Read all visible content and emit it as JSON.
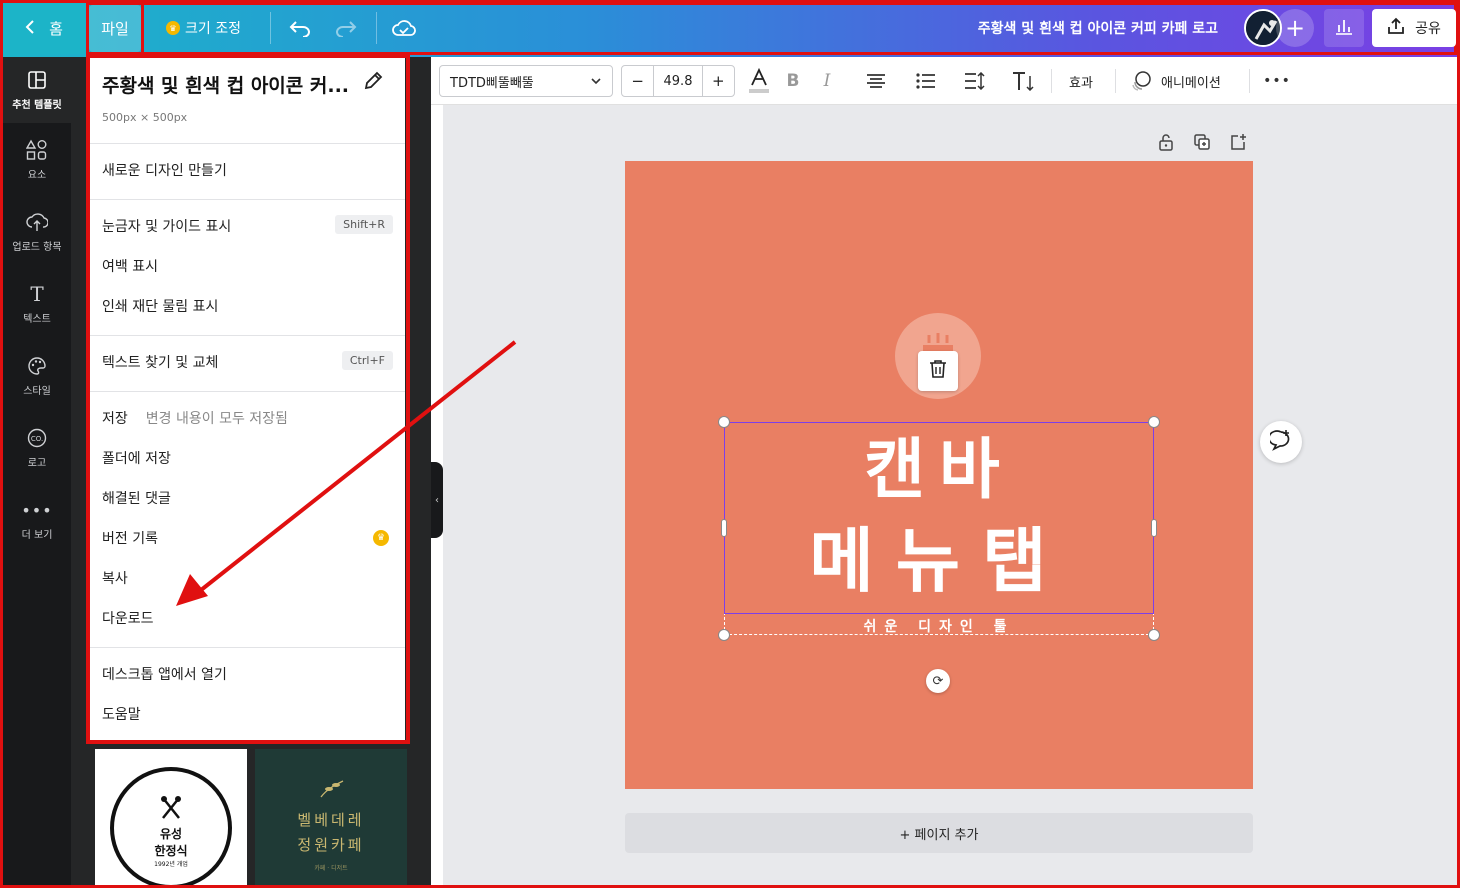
{
  "topbar": {
    "home_label": "홈",
    "file_label": "파일",
    "resize_label": "크기 조정",
    "doc_title": "주황색 및 흰색 컵 아이콘 커피 카페 로고",
    "share_label": "공유"
  },
  "rail": {
    "items": [
      {
        "label": "추천 템플릿",
        "icon": "template-icon"
      },
      {
        "label": "요소",
        "icon": "elements-icon"
      },
      {
        "label": "업로드 항목",
        "icon": "upload-icon"
      },
      {
        "label": "텍스트",
        "icon": "text-icon"
      },
      {
        "label": "스타일",
        "icon": "palette-icon"
      },
      {
        "label": "로고",
        "icon": "logo-icon"
      },
      {
        "label": "더 보기",
        "icon": "more-icon"
      }
    ]
  },
  "menu": {
    "title": "주황색 및 흰색 컵 아이콘 커...",
    "dimensions": "500px × 500px",
    "new_design": "새로운 디자인 만들기",
    "rulers": "눈금자 및 가이드 표시",
    "rulers_kbd": "Shift+R",
    "margins": "여백 표시",
    "bleed": "인쇄 재단 물림 표시",
    "find_replace": "텍스트 찾기 및 교체",
    "find_kbd": "Ctrl+F",
    "save": "저장",
    "save_status": "변경 내용이 모두 저장됨",
    "save_folder": "폴더에 저장",
    "resolved_comments": "해결된 댓글",
    "version_history": "버전 기록",
    "copy": "복사",
    "download": "다운로드",
    "open_desktop": "데스크톱 앱에서 열기",
    "help": "도움말"
  },
  "toolbar": {
    "font": "TDTD삐뚤빼뚤",
    "font_size": "49.8",
    "minus": "−",
    "plus": "+",
    "effects": "효과",
    "animation": "애니메이션"
  },
  "canvas": {
    "line1": "캔바",
    "line2": "메뉴탭",
    "subtitle": "쉬운 디자인 툴",
    "bg_color": "#e97f63"
  },
  "templates": {
    "t1_name": "유성",
    "t1_sub": "한정식",
    "t1_year": "1992년 개업",
    "t2_line1": "벨베데레",
    "t2_line2": "정원카페",
    "t2_small": "카페 · 디저트"
  },
  "add_page": "+ 페이지 추가",
  "colors": {
    "highlight": "#e01010",
    "selection": "#7d3fe8",
    "crown": "#f5b800"
  }
}
